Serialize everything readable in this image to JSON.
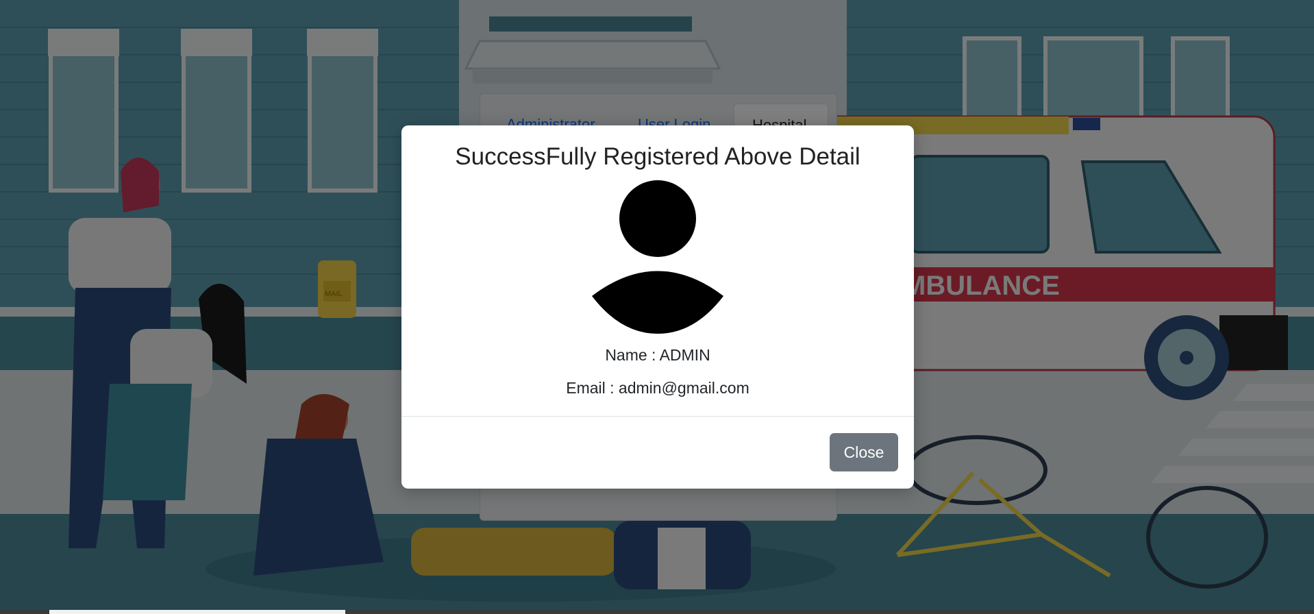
{
  "tabs": {
    "administrator": "Administrator",
    "user_login": "User Login",
    "hospital": "Hospital"
  },
  "background": {
    "vehicle_text": "MBULANCE",
    "mailbox_text": "MAIL"
  },
  "modal": {
    "title": "SuccessFully Registered Above Detail",
    "name_line": "Name : ADMIN",
    "email_line": "Email : admin@gmail.com",
    "close_label": "Close"
  },
  "colors": {
    "overlay": "rgba(0,0,0,0.5)",
    "close_button": "#6c757d",
    "tab_link": "#0d6efd"
  }
}
